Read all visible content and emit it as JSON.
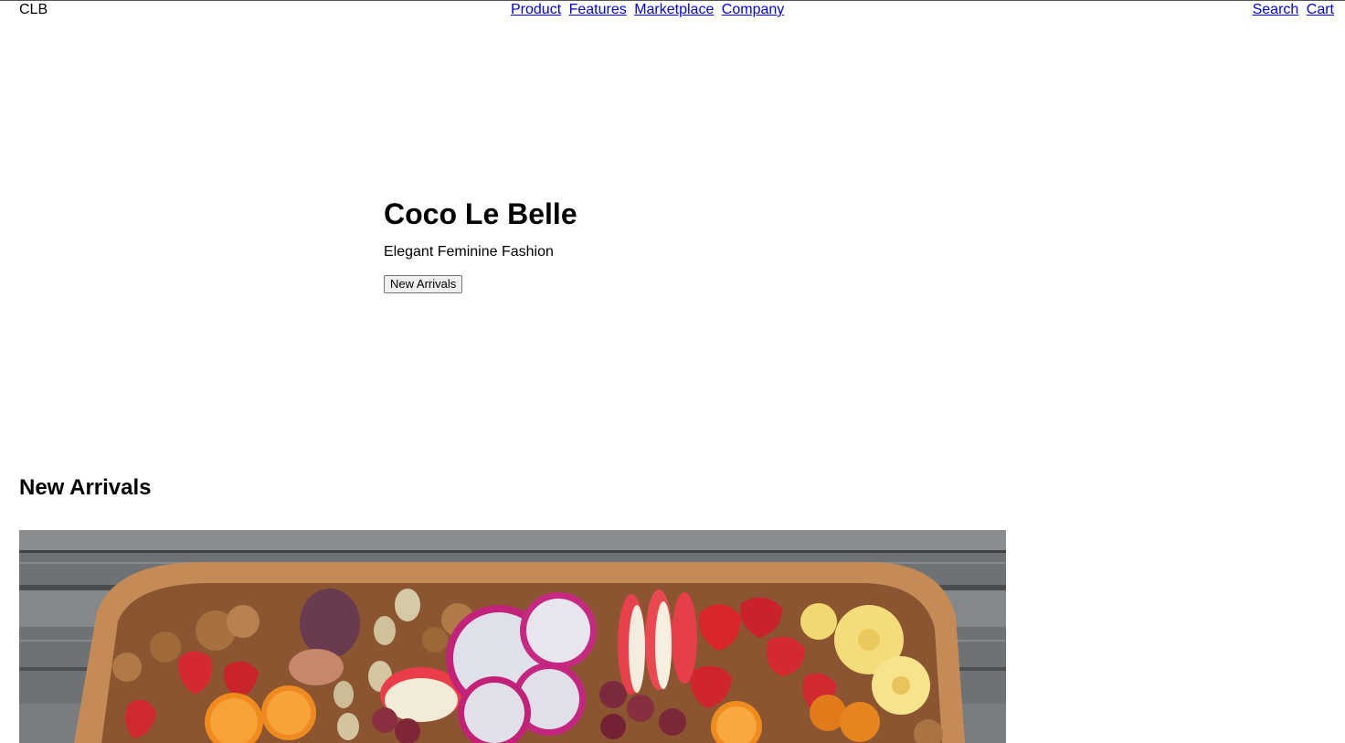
{
  "header": {
    "logo": "CLB",
    "nav": [
      {
        "label": "Product"
      },
      {
        "label": "Features"
      },
      {
        "label": "Marketplace"
      },
      {
        "label": "Company"
      }
    ],
    "actions": [
      {
        "label": "Search"
      },
      {
        "label": "Cart"
      }
    ],
    "link_color": "#0000ee"
  },
  "hero": {
    "title": "Coco Le Belle",
    "subtitle": "Elegant Feminine Fashion",
    "button_label": "New Arrivals"
  },
  "new_arrivals": {
    "heading": "New Arrivals",
    "image_icon": "fruit-platter-photo"
  }
}
